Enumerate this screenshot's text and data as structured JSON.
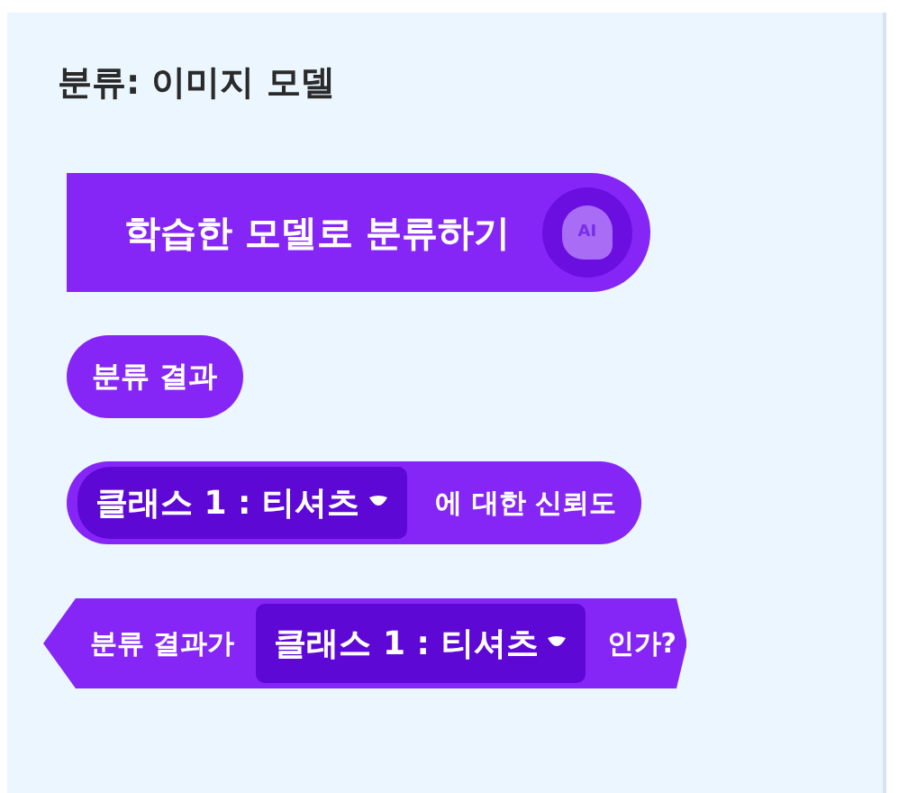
{
  "category_title": "분류: 이미지 모델",
  "blocks": [
    {
      "kind": "command",
      "parts": [
        {
          "kind": "text",
          "text": "학습한 모델로 분류하기"
        },
        {
          "kind": "icon",
          "text": "AI"
        }
      ]
    },
    {
      "kind": "reporter",
      "parts": [
        {
          "kind": "text",
          "text": "분류 결과"
        }
      ]
    },
    {
      "kind": "reporter",
      "parts": [
        {
          "kind": "dropdown",
          "text": "클래스 1 : 티셔츠"
        },
        {
          "kind": "text",
          "text": "에 대한 신뢰도"
        }
      ]
    },
    {
      "kind": "boolean",
      "parts": [
        {
          "kind": "text",
          "text": "분류 결과가"
        },
        {
          "kind": "dropdown",
          "text": "클래스 1 : 티셔츠"
        },
        {
          "kind": "text",
          "text": "인가?"
        }
      ]
    }
  ]
}
